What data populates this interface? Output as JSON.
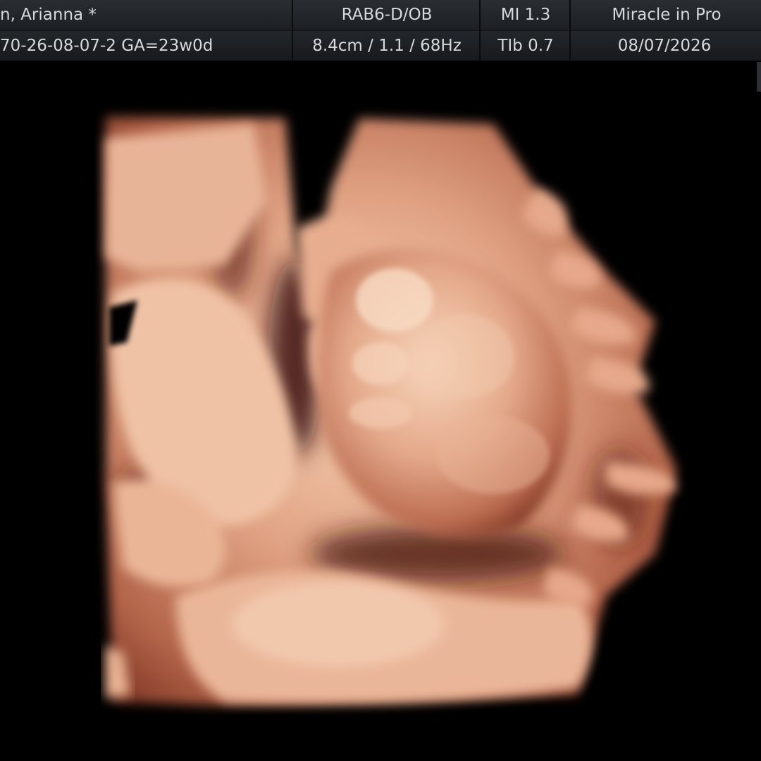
{
  "header": {
    "patient_name": "n, Arianna  *",
    "patient_id_ga": "70-26-08-07-2  GA=23w0d",
    "probe_preset": "RAB6-D/OB",
    "depth_info": "8.4cm / 1.1 / 68Hz",
    "mi": "MI  1.3",
    "tib": "TIb  0.7",
    "institution": "Miracle in Pro",
    "date": "08/07/2026"
  },
  "colors": {
    "background": "#000000",
    "header_bg": "#1c1f23",
    "header_text": "#d6d9dc",
    "tissue_light": "#f2c6a8",
    "tissue_mid": "#c9785a",
    "tissue_dark": "#6e2a1a"
  }
}
